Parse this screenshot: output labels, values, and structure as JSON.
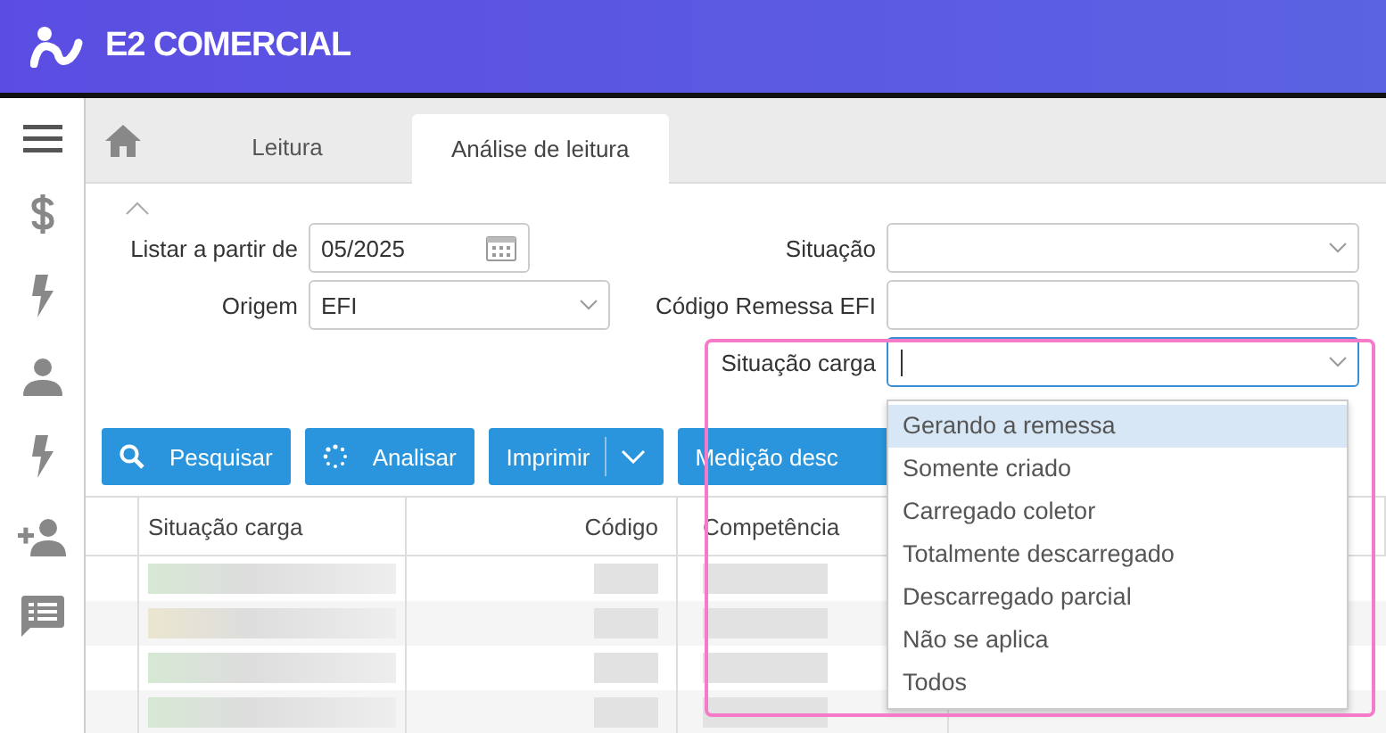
{
  "app": {
    "title": "E2 COMERCIAL"
  },
  "tabs": [
    {
      "label": "Leitura",
      "selected": false
    },
    {
      "label": "Análise de leitura",
      "selected": true
    }
  ],
  "form": {
    "left": [
      {
        "label": "Listar a partir de",
        "kind": "date",
        "value": "05/2025"
      },
      {
        "label": "Origem",
        "kind": "select",
        "value": "EFI"
      }
    ],
    "right": [
      {
        "label": "Situação",
        "kind": "select",
        "focused": false
      },
      {
        "label": "Código Remessa EFI",
        "kind": "text"
      },
      {
        "label": "Situação carga",
        "kind": "select",
        "focused": true
      }
    ]
  },
  "buttons": [
    {
      "label": "Pesquisar",
      "kind": "search"
    },
    {
      "label": "Analisar",
      "kind": "spinner"
    },
    {
      "label": "Imprimir",
      "kind": "split"
    },
    {
      "label": "Medição desc",
      "kind": "plain"
    }
  ],
  "table": {
    "columns": [
      "Situação carga",
      "Código",
      "Competência"
    ],
    "rows": [
      {
        "color": "#d6e8d4"
      },
      {
        "color": "#ebe6d0"
      },
      {
        "color": "#d6e8d4"
      },
      {
        "color": "#d6e8d4"
      }
    ]
  },
  "dropdown": {
    "options": [
      {
        "label": "Gerando a remessa",
        "selected": true
      },
      {
        "label": "Somente criado",
        "selected": false
      },
      {
        "label": "Carregado coletor",
        "selected": false
      },
      {
        "label": "Totalmente descarregado",
        "selected": false
      },
      {
        "label": "Descarregado parcial",
        "selected": false
      },
      {
        "label": "Não se aplica",
        "selected": false
      },
      {
        "label": "Todos",
        "selected": false
      }
    ]
  }
}
